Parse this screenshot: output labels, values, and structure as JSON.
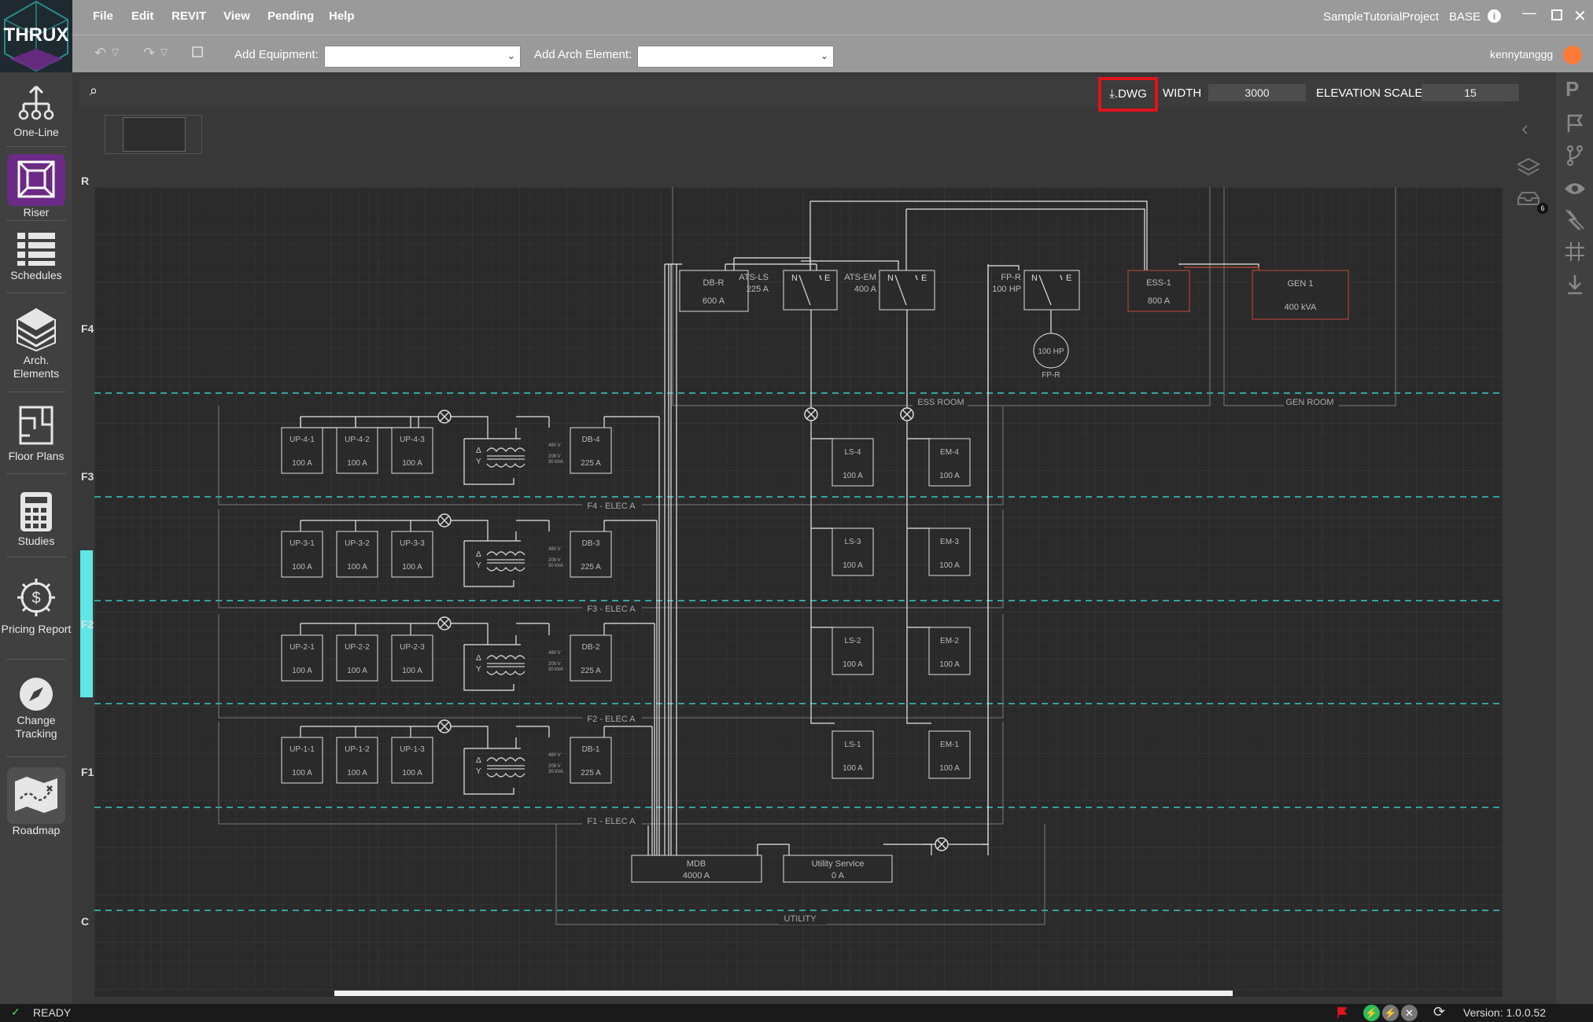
{
  "app": {
    "logo": "THRUX",
    "project": "SampleTutorialProject",
    "base": "BASE",
    "user": "kennytanggg"
  },
  "menu": [
    "File",
    "Edit",
    "REVIT",
    "View",
    "Pending",
    "Help"
  ],
  "toolbar": {
    "add_equipment": "Add Equipment:",
    "add_arch": "Add Arch Element:"
  },
  "nav": [
    {
      "label": "One-Line",
      "icon": "one-line-icon"
    },
    {
      "label": "Riser",
      "icon": "riser-cube-icon"
    },
    {
      "label": "Schedules",
      "icon": "schedules-list-icon"
    },
    {
      "label": "Arch. Elements",
      "icon": "arch-layers-icon"
    },
    {
      "label": "Floor Plans",
      "icon": "floor-plan-icon"
    },
    {
      "label": "Studies",
      "icon": "calculator-icon"
    },
    {
      "label": "Pricing Report",
      "icon": "dollar-gear-icon"
    },
    {
      "label": "Change Tracking",
      "icon": "compass-icon"
    },
    {
      "label": "Roadmap",
      "icon": "map-icon"
    }
  ],
  "canvas": {
    "dwg_label": ".DWG",
    "width_label": "WIDTH",
    "width_value": "3000",
    "elev_label": "ELEVATION SCALE",
    "elev_value": "15"
  },
  "floors": [
    "R",
    "F4",
    "F3",
    "F2",
    "F1",
    "C"
  ],
  "zones": [
    "ESS ROOM",
    "GEN ROOM",
    "F4 - ELEC A",
    "F3 - ELEC A",
    "F2 - ELEC A",
    "F1 - ELEC A",
    "UTILITY"
  ],
  "equipment": {
    "top": [
      {
        "name": "DB-R",
        "rating": "600 A"
      },
      {
        "name": "ATS-LS",
        "rating": "225 A"
      },
      {
        "name": "ATS-EM",
        "rating": "400 A"
      },
      {
        "name": "FP-R",
        "rating": "100 HP"
      },
      {
        "name": "ESS-1",
        "rating": "800 A"
      },
      {
        "name": "GEN 1",
        "rating": "400 kVA"
      }
    ],
    "motor": {
      "name": "FP-R",
      "rating": "100 HP"
    },
    "ats_letters": [
      "N",
      "E"
    ],
    "floors": [
      {
        "ups": [
          {
            "name": "UP-4-1",
            "rating": "100 A"
          },
          {
            "name": "UP-4-2",
            "rating": "100 A"
          },
          {
            "name": "UP-4-3",
            "rating": "100 A"
          }
        ],
        "db": {
          "name": "DB-4",
          "rating": "225 A"
        },
        "ls": {
          "name": "LS-4",
          "rating": "100 A"
        },
        "em": {
          "name": "EM-4",
          "rating": "100 A"
        }
      },
      {
        "ups": [
          {
            "name": "UP-3-1",
            "rating": "100 A"
          },
          {
            "name": "UP-3-2",
            "rating": "100 A"
          },
          {
            "name": "UP-3-3",
            "rating": "100 A"
          }
        ],
        "db": {
          "name": "DB-3",
          "rating": "225 A"
        },
        "ls": {
          "name": "LS-3",
          "rating": "100 A"
        },
        "em": {
          "name": "EM-3",
          "rating": "100 A"
        }
      },
      {
        "ups": [
          {
            "name": "UP-2-1",
            "rating": "100 A"
          },
          {
            "name": "UP-2-2",
            "rating": "100 A"
          },
          {
            "name": "UP-2-3",
            "rating": "100 A"
          }
        ],
        "db": {
          "name": "DB-2",
          "rating": "225 A"
        },
        "ls": {
          "name": "LS-2",
          "rating": "100 A"
        },
        "em": {
          "name": "EM-2",
          "rating": "100 A"
        }
      },
      {
        "ups": [
          {
            "name": "UP-1-1",
            "rating": "100 A"
          },
          {
            "name": "UP-1-2",
            "rating": "100 A"
          },
          {
            "name": "UP-1-3",
            "rating": "100 A"
          }
        ],
        "db": {
          "name": "DB-1",
          "rating": "225 A"
        },
        "ls": {
          "name": "LS-1",
          "rating": "100 A"
        },
        "em": {
          "name": "EM-1",
          "rating": "100 A"
        }
      }
    ],
    "xfmr": {
      "v1": "480 V",
      "v2": "208 V",
      "kva": "30 kVA"
    },
    "mdb": {
      "name": "MDB",
      "rating": "4000 A"
    },
    "utility": {
      "name": "Utility Service",
      "rating": "0 A"
    }
  },
  "badge_count": "6",
  "status": {
    "text": "READY",
    "version": "Version: 1.0.0.52"
  },
  "colors": {
    "accent_cyan": "#5ee6e6",
    "highlight_red": "#e0141e",
    "purple": "#6b2a86",
    "orange": "#ff7b3a"
  }
}
